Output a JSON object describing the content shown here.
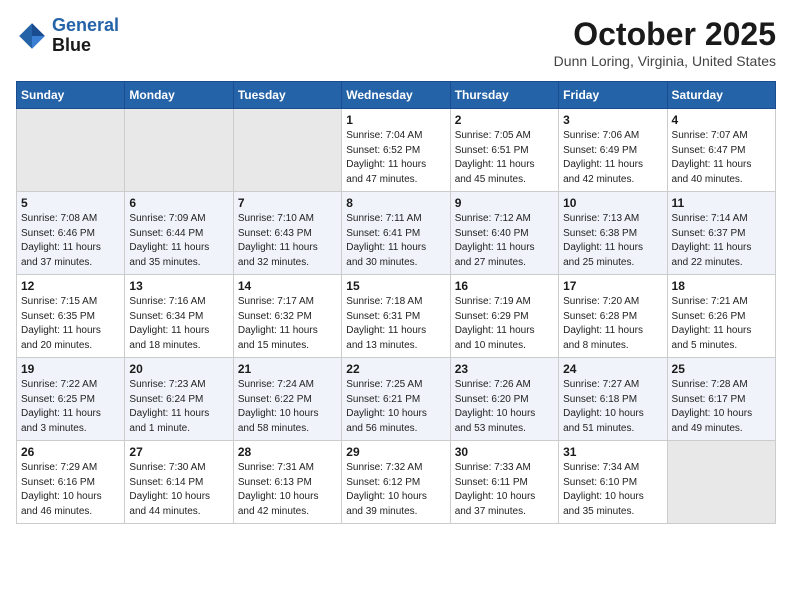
{
  "header": {
    "logo_line1": "General",
    "logo_line2": "Blue",
    "month": "October 2025",
    "location": "Dunn Loring, Virginia, United States"
  },
  "weekdays": [
    "Sunday",
    "Monday",
    "Tuesday",
    "Wednesday",
    "Thursday",
    "Friday",
    "Saturday"
  ],
  "weeks": [
    [
      {
        "day": "",
        "detail": ""
      },
      {
        "day": "",
        "detail": ""
      },
      {
        "day": "",
        "detail": ""
      },
      {
        "day": "1",
        "detail": "Sunrise: 7:04 AM\nSunset: 6:52 PM\nDaylight: 11 hours\nand 47 minutes."
      },
      {
        "day": "2",
        "detail": "Sunrise: 7:05 AM\nSunset: 6:51 PM\nDaylight: 11 hours\nand 45 minutes."
      },
      {
        "day": "3",
        "detail": "Sunrise: 7:06 AM\nSunset: 6:49 PM\nDaylight: 11 hours\nand 42 minutes."
      },
      {
        "day": "4",
        "detail": "Sunrise: 7:07 AM\nSunset: 6:47 PM\nDaylight: 11 hours\nand 40 minutes."
      }
    ],
    [
      {
        "day": "5",
        "detail": "Sunrise: 7:08 AM\nSunset: 6:46 PM\nDaylight: 11 hours\nand 37 minutes."
      },
      {
        "day": "6",
        "detail": "Sunrise: 7:09 AM\nSunset: 6:44 PM\nDaylight: 11 hours\nand 35 minutes."
      },
      {
        "day": "7",
        "detail": "Sunrise: 7:10 AM\nSunset: 6:43 PM\nDaylight: 11 hours\nand 32 minutes."
      },
      {
        "day": "8",
        "detail": "Sunrise: 7:11 AM\nSunset: 6:41 PM\nDaylight: 11 hours\nand 30 minutes."
      },
      {
        "day": "9",
        "detail": "Sunrise: 7:12 AM\nSunset: 6:40 PM\nDaylight: 11 hours\nand 27 minutes."
      },
      {
        "day": "10",
        "detail": "Sunrise: 7:13 AM\nSunset: 6:38 PM\nDaylight: 11 hours\nand 25 minutes."
      },
      {
        "day": "11",
        "detail": "Sunrise: 7:14 AM\nSunset: 6:37 PM\nDaylight: 11 hours\nand 22 minutes."
      }
    ],
    [
      {
        "day": "12",
        "detail": "Sunrise: 7:15 AM\nSunset: 6:35 PM\nDaylight: 11 hours\nand 20 minutes."
      },
      {
        "day": "13",
        "detail": "Sunrise: 7:16 AM\nSunset: 6:34 PM\nDaylight: 11 hours\nand 18 minutes."
      },
      {
        "day": "14",
        "detail": "Sunrise: 7:17 AM\nSunset: 6:32 PM\nDaylight: 11 hours\nand 15 minutes."
      },
      {
        "day": "15",
        "detail": "Sunrise: 7:18 AM\nSunset: 6:31 PM\nDaylight: 11 hours\nand 13 minutes."
      },
      {
        "day": "16",
        "detail": "Sunrise: 7:19 AM\nSunset: 6:29 PM\nDaylight: 11 hours\nand 10 minutes."
      },
      {
        "day": "17",
        "detail": "Sunrise: 7:20 AM\nSunset: 6:28 PM\nDaylight: 11 hours\nand 8 minutes."
      },
      {
        "day": "18",
        "detail": "Sunrise: 7:21 AM\nSunset: 6:26 PM\nDaylight: 11 hours\nand 5 minutes."
      }
    ],
    [
      {
        "day": "19",
        "detail": "Sunrise: 7:22 AM\nSunset: 6:25 PM\nDaylight: 11 hours\nand 3 minutes."
      },
      {
        "day": "20",
        "detail": "Sunrise: 7:23 AM\nSunset: 6:24 PM\nDaylight: 11 hours\nand 1 minute."
      },
      {
        "day": "21",
        "detail": "Sunrise: 7:24 AM\nSunset: 6:22 PM\nDaylight: 10 hours\nand 58 minutes."
      },
      {
        "day": "22",
        "detail": "Sunrise: 7:25 AM\nSunset: 6:21 PM\nDaylight: 10 hours\nand 56 minutes."
      },
      {
        "day": "23",
        "detail": "Sunrise: 7:26 AM\nSunset: 6:20 PM\nDaylight: 10 hours\nand 53 minutes."
      },
      {
        "day": "24",
        "detail": "Sunrise: 7:27 AM\nSunset: 6:18 PM\nDaylight: 10 hours\nand 51 minutes."
      },
      {
        "day": "25",
        "detail": "Sunrise: 7:28 AM\nSunset: 6:17 PM\nDaylight: 10 hours\nand 49 minutes."
      }
    ],
    [
      {
        "day": "26",
        "detail": "Sunrise: 7:29 AM\nSunset: 6:16 PM\nDaylight: 10 hours\nand 46 minutes."
      },
      {
        "day": "27",
        "detail": "Sunrise: 7:30 AM\nSunset: 6:14 PM\nDaylight: 10 hours\nand 44 minutes."
      },
      {
        "day": "28",
        "detail": "Sunrise: 7:31 AM\nSunset: 6:13 PM\nDaylight: 10 hours\nand 42 minutes."
      },
      {
        "day": "29",
        "detail": "Sunrise: 7:32 AM\nSunset: 6:12 PM\nDaylight: 10 hours\nand 39 minutes."
      },
      {
        "day": "30",
        "detail": "Sunrise: 7:33 AM\nSunset: 6:11 PM\nDaylight: 10 hours\nand 37 minutes."
      },
      {
        "day": "31",
        "detail": "Sunrise: 7:34 AM\nSunset: 6:10 PM\nDaylight: 10 hours\nand 35 minutes."
      },
      {
        "day": "",
        "detail": ""
      }
    ]
  ]
}
